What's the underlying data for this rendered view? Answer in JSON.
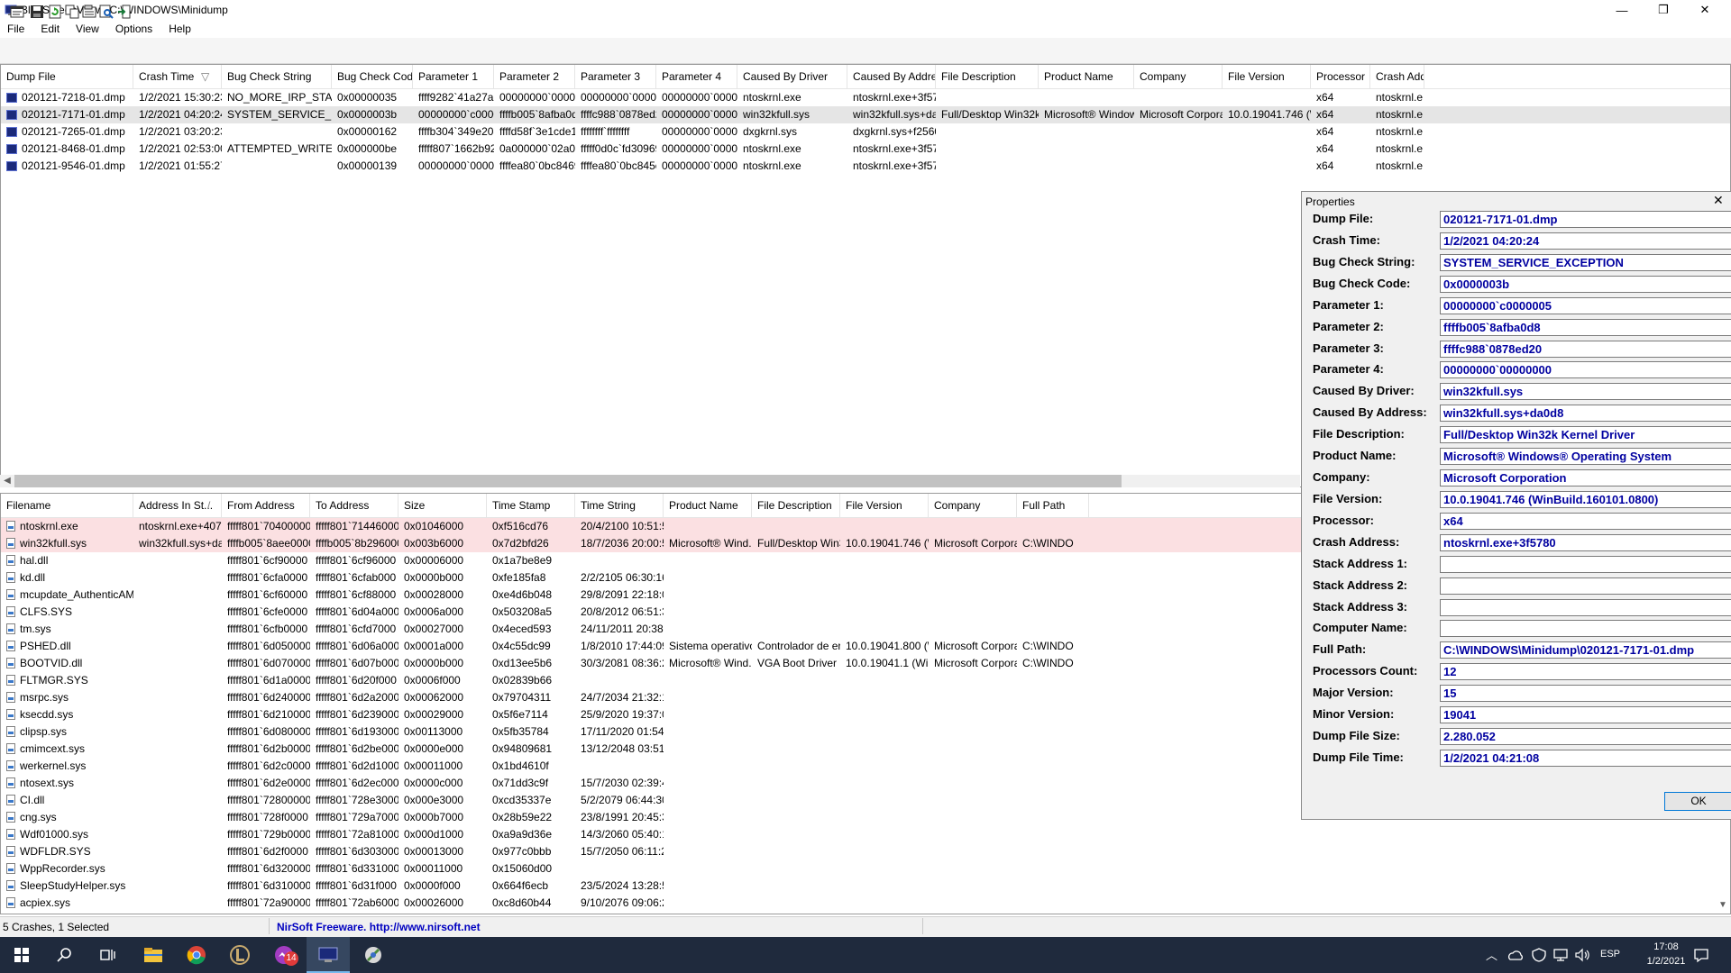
{
  "window": {
    "title": "BlueScreenView - C:\\WINDOWS\\Minidump",
    "minimize_glyph": "—",
    "maximize_glyph": "❐",
    "close_glyph": "✕"
  },
  "menu": [
    "File",
    "Edit",
    "View",
    "Options",
    "Help"
  ],
  "toolbar": {
    "icons": [
      "properties-icon",
      "save-icon",
      "refresh-icon",
      "copy-icon",
      "html-report-icon",
      "find-icon",
      "exit-icon"
    ]
  },
  "top_table": {
    "columns": [
      "Dump File",
      "Crash Time",
      "Bug Check String",
      "Bug Check Code",
      "Parameter 1",
      "Parameter 2",
      "Parameter 3",
      "Parameter 4",
      "Caused By Driver",
      "Caused By Address",
      "File Description",
      "Product Name",
      "Company",
      "File Version",
      "Processor",
      "Crash Add"
    ],
    "sort_glyph": "▽",
    "rows": [
      [
        "020121-7218-01.dmp",
        "1/2/2021 15:30:23",
        "NO_MORE_IRP_STACK_L...",
        "0x00000035",
        "ffff9282`41a27a60",
        "00000000`000000...",
        "00000000`000000...",
        "00000000`000000...",
        "ntoskrnl.exe",
        "ntoskrnl.exe+3f5780",
        "",
        "",
        "",
        "",
        "x64",
        "ntoskrnl.e"
      ],
      [
        "020121-7171-01.dmp",
        "1/2/2021 04:20:24",
        "SYSTEM_SERVICE_EXCEP...",
        "0x0000003b",
        "00000000`c0000...",
        "ffffb005`8afba0d8",
        "ffffc988`0878ed20",
        "00000000`000000...",
        "win32kfull.sys",
        "win32kfull.sys+da...",
        "Full/Desktop Win32k K...",
        "Microsoft® Window...",
        "Microsoft Corpora...",
        "10.0.19041.746 (Wi...",
        "x64",
        "ntoskrnl.e"
      ],
      [
        "020121-7265-01.dmp",
        "1/2/2021 03:20:23",
        "",
        "0x00000162",
        "ffffb304`349e2080",
        "ffffd58f`3e1cde10",
        "ffffffff`ffffffff",
        "00000000`000000...",
        "dxgkrnl.sys",
        "dxgkrnl.sys+f2560",
        "",
        "",
        "",
        "",
        "x64",
        "ntoskrnl.e"
      ],
      [
        "020121-8468-01.dmp",
        "1/2/2021 02:53:00",
        "ATTEMPTED_WRITE_TO_...",
        "0x000000be",
        "fffff807`1662b92e",
        "0a000000`02a001...",
        "fffff0d0c`fd309690",
        "00000000`0000000f",
        "ntoskrnl.exe",
        "ntoskrnl.exe+3f5780",
        "",
        "",
        "",
        "",
        "x64",
        "ntoskrnl.e"
      ],
      [
        "020121-9546-01.dmp",
        "1/2/2021 01:55:27",
        "",
        "0x00000139",
        "00000000`000000...",
        "ffffea80`0bc84690",
        "ffffea80`0bc845e8",
        "00000000`000000...",
        "ntoskrnl.exe",
        "ntoskrnl.exe+3f5780",
        "",
        "",
        "",
        "",
        "x64",
        "ntoskrnl.e"
      ]
    ]
  },
  "bottom_table": {
    "columns": [
      "Filename",
      "Address In St...",
      "From Address",
      "To Address",
      "Size",
      "Time Stamp",
      "Time String",
      "Product Name",
      "File Description",
      "File Version",
      "Company",
      "Full Path"
    ],
    "sort_glyph": "/",
    "rows": [
      [
        "ntoskrnl.exe",
        "ntoskrnl.exe+407769",
        "fffff801`70400000",
        "fffff801`71446000",
        "0x01046000",
        "0xf516cd76",
        "20/4/2100 10:51:50",
        "",
        "",
        "",
        "",
        ""
      ],
      [
        "win32kfull.sys",
        "win32kfull.sys+da...",
        "ffffb005`8aee0000",
        "ffffb005`8b296000",
        "0x003b6000",
        "0x7d2bfd26",
        "18/7/2036 20:00:54",
        "Microsoft® Wind...",
        "Full/Desktop Win3...",
        "10.0.19041.746 (Wi...",
        "Microsoft Corpora...",
        "C:\\WINDO"
      ],
      [
        "hal.dll",
        "",
        "fffff801`6cf90000",
        "fffff801`6cf96000",
        "0x00006000",
        "0x1a7be8e9",
        "",
        "",
        "",
        "",
        "",
        ""
      ],
      [
        "kd.dll",
        "",
        "fffff801`6cfa0000",
        "fffff801`6cfab000",
        "0x0000b000",
        "0xfe185fa8",
        "2/2/2105 06:30:16",
        "",
        "",
        "",
        "",
        ""
      ],
      [
        "mcupdate_AuthenticAMD.dll",
        "",
        "fffff801`6cf60000",
        "fffff801`6cf88000",
        "0x00028000",
        "0xe4d6b048",
        "29/8/2091 22:18:00",
        "",
        "",
        "",
        "",
        ""
      ],
      [
        "CLFS.SYS",
        "",
        "fffff801`6cfe0000",
        "fffff801`6d04a000",
        "0x0006a000",
        "0x503208a5",
        "20/8/2012 06:51:33",
        "",
        "",
        "",
        "",
        ""
      ],
      [
        "tm.sys",
        "",
        "fffff801`6cfb0000",
        "fffff801`6cfd7000",
        "0x00027000",
        "0x4eced593",
        "24/11/2011 20:38:59",
        "",
        "",
        "",
        "",
        ""
      ],
      [
        "PSHED.dll",
        "",
        "fffff801`6d050000",
        "fffff801`6d06a000",
        "0x0001a000",
        "0x4c55dc99",
        "1/8/2010 17:44:09",
        "Sistema operativo ...",
        "Controlador de err...",
        "10.0.19041.800 (Wi...",
        "Microsoft Corpora...",
        "C:\\WINDO"
      ],
      [
        "BOOTVID.dll",
        "",
        "fffff801`6d070000",
        "fffff801`6d07b000",
        "0x0000b000",
        "0xd13ee5b6",
        "30/3/2081 08:36:22",
        "Microsoft® Wind...",
        "VGA Boot Driver",
        "10.0.19041.1 (WinB...",
        "Microsoft Corpora...",
        "C:\\WINDO"
      ],
      [
        "FLTMGR.SYS",
        "",
        "fffff801`6d1a0000",
        "fffff801`6d20f000",
        "0x0006f000",
        "0x02839b66",
        "",
        "",
        "",
        "",
        "",
        ""
      ],
      [
        "msrpc.sys",
        "",
        "fffff801`6d240000",
        "fffff801`6d2a2000",
        "0x00062000",
        "0x79704311",
        "24/7/2034 21:32:17",
        "",
        "",
        "",
        "",
        ""
      ],
      [
        "ksecdd.sys",
        "",
        "fffff801`6d210000",
        "fffff801`6d239000",
        "0x00029000",
        "0x5f6e7114",
        "25/9/2020 19:37:08",
        "",
        "",
        "",
        "",
        ""
      ],
      [
        "clipsp.sys",
        "",
        "fffff801`6d080000",
        "fffff801`6d193000",
        "0x00113000",
        "0x5fb35784",
        "17/11/2020 01:54:28",
        "",
        "",
        "",
        "",
        ""
      ],
      [
        "cmimcext.sys",
        "",
        "fffff801`6d2b0000",
        "fffff801`6d2be000",
        "0x0000e000",
        "0x94809681",
        "13/12/2048 03:51:45",
        "",
        "",
        "",
        "",
        ""
      ],
      [
        "werkernel.sys",
        "",
        "fffff801`6d2c0000",
        "fffff801`6d2d1000",
        "0x00011000",
        "0x1bd4610f",
        "",
        "",
        "",
        "",
        "",
        ""
      ],
      [
        "ntosext.sys",
        "",
        "fffff801`6d2e0000",
        "fffff801`6d2ec000",
        "0x0000c000",
        "0x71dd3c9f",
        "15/7/2030 02:39:43",
        "",
        "",
        "",
        "",
        ""
      ],
      [
        "CI.dll",
        "",
        "fffff801`72800000",
        "fffff801`728e3000",
        "0x000e3000",
        "0xcd35337e",
        "5/2/2079 06:44:30",
        "",
        "",
        "",
        "",
        ""
      ],
      [
        "cng.sys",
        "",
        "fffff801`728f0000",
        "fffff801`729a7000",
        "0x000b7000",
        "0x28b59e22",
        "23/8/1991 20:45:38",
        "",
        "",
        "",
        "",
        ""
      ],
      [
        "Wdf01000.sys",
        "",
        "fffff801`729b0000",
        "fffff801`72a81000",
        "0x000d1000",
        "0xa9a9d36e",
        "14/3/2060 05:40:14",
        "",
        "",
        "",
        "",
        ""
      ],
      [
        "WDFLDR.SYS",
        "",
        "fffff801`6d2f0000",
        "fffff801`6d303000",
        "0x00013000",
        "0x977c0bbb",
        "15/7/2050 06:11:23",
        "",
        "",
        "",
        "",
        ""
      ],
      [
        "WppRecorder.sys",
        "",
        "fffff801`6d320000",
        "fffff801`6d331000",
        "0x00011000",
        "0x15060d00",
        "",
        "",
        "",
        "",
        "",
        ""
      ],
      [
        "SleepStudyHelper.sys",
        "",
        "fffff801`6d310000",
        "fffff801`6d31f000",
        "0x0000f000",
        "0x664f6ecb",
        "23/5/2024 13:28:59",
        "",
        "",
        "",
        "",
        ""
      ],
      [
        "acpiex.sys",
        "",
        "fffff801`72a90000",
        "fffff801`72ab6000",
        "0x00026000",
        "0xc8d60b44",
        "9/10/2076 09:06:28",
        "",
        "",
        "",
        "",
        ""
      ]
    ]
  },
  "status": {
    "count": "5 Crashes, 1 Selected",
    "freeware": "NirSoft Freeware.  http://www.nirsoft.net"
  },
  "properties": {
    "title": "Properties",
    "close_glyph": "✕",
    "ok_label": "OK",
    "fields": [
      {
        "label": "Dump File:",
        "value": "020121-7171-01.dmp"
      },
      {
        "label": "Crash Time:",
        "value": "1/2/2021 04:20:24"
      },
      {
        "label": "Bug Check String:",
        "value": "SYSTEM_SERVICE_EXCEPTION"
      },
      {
        "label": "Bug Check Code:",
        "value": "0x0000003b"
      },
      {
        "label": "Parameter 1:",
        "value": "00000000`c0000005"
      },
      {
        "label": "Parameter 2:",
        "value": "ffffb005`8afba0d8"
      },
      {
        "label": "Parameter 3:",
        "value": "ffffc988`0878ed20"
      },
      {
        "label": "Parameter 4:",
        "value": "00000000`00000000"
      },
      {
        "label": "Caused By Driver:",
        "value": "win32kfull.sys"
      },
      {
        "label": "Caused By Address:",
        "value": "win32kfull.sys+da0d8"
      },
      {
        "label": "File Description:",
        "value": "Full/Desktop Win32k Kernel Driver"
      },
      {
        "label": "Product Name:",
        "value": "Microsoft® Windows® Operating System"
      },
      {
        "label": "Company:",
        "value": "Microsoft Corporation"
      },
      {
        "label": "File Version:",
        "value": "10.0.19041.746 (WinBuild.160101.0800)"
      },
      {
        "label": "Processor:",
        "value": "x64"
      },
      {
        "label": "Crash Address:",
        "value": "ntoskrnl.exe+3f5780"
      },
      {
        "label": "Stack Address 1:",
        "value": ""
      },
      {
        "label": "Stack Address 2:",
        "value": ""
      },
      {
        "label": "Stack Address 3:",
        "value": ""
      },
      {
        "label": "Computer Name:",
        "value": ""
      },
      {
        "label": "Full Path:",
        "value": "C:\\WINDOWS\\Minidump\\020121-7171-01.dmp"
      },
      {
        "label": "Processors Count:",
        "value": "12"
      },
      {
        "label": "Major Version:",
        "value": "15"
      },
      {
        "label": "Minor Version:",
        "value": "19041"
      },
      {
        "label": "Dump File Size:",
        "value": "2.280.052"
      },
      {
        "label": "Dump File Time:",
        "value": "1/2/2021 04:21:08"
      }
    ]
  },
  "taskbar": {
    "icons": [
      "windows-start-icon",
      "search-icon",
      "task-view-icon",
      "file-explorer-icon",
      "chrome-icon",
      "league-icon",
      "messenger-icon",
      "bluescreenview-icon",
      "app-icon"
    ],
    "badge": "14",
    "language": "ESP",
    "time": "17:08",
    "date": "1/2/2021"
  },
  "colors": {
    "selected_row": "#e5e5e5",
    "highlight_row": "#fbe0e2",
    "prop_value_text": "#0000a0",
    "taskbar": "#1f2a3d",
    "ok_border": "#0078d7"
  }
}
